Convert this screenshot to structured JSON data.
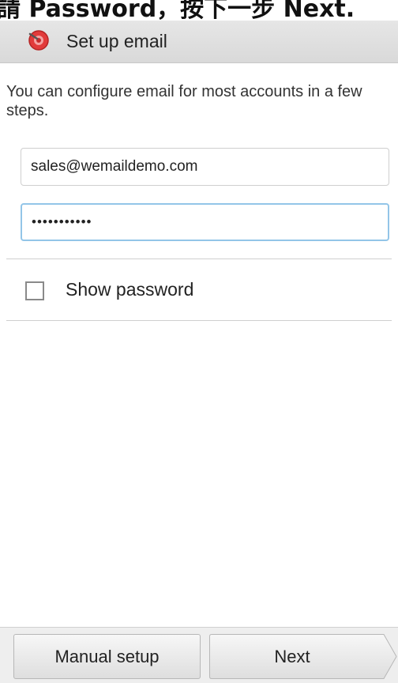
{
  "caption": {
    "text": "請 Password，按下一步 Next."
  },
  "action_bar": {
    "title": "Set up email",
    "icon": "email-app-icon",
    "accent": "#e23b3b"
  },
  "intro": {
    "text": "You can configure email for most accounts in a few steps."
  },
  "form": {
    "email_value": "sales@wemaildemo.com",
    "password_mask": "•••••••••••",
    "show_password_label": "Show password",
    "show_password_checked": false
  },
  "buttons": {
    "manual_setup": "Manual setup",
    "next": "Next"
  }
}
